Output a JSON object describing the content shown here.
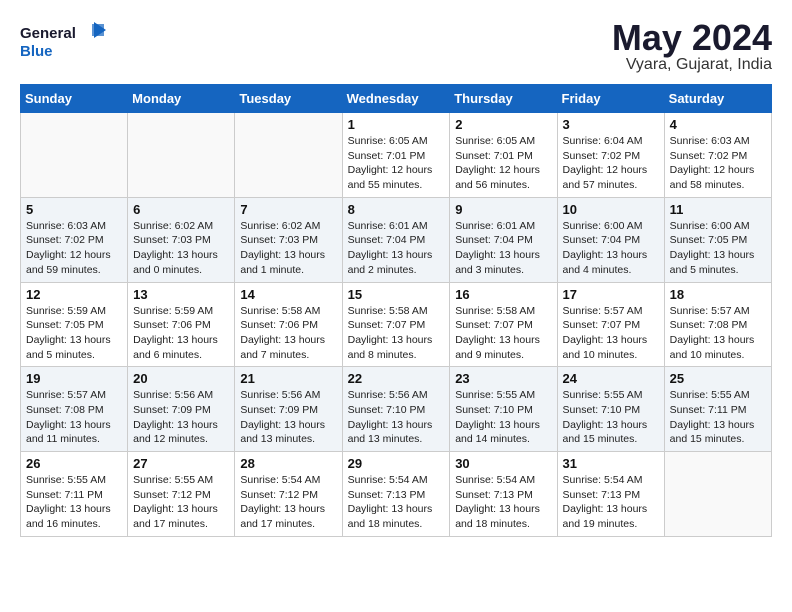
{
  "logo": {
    "line1": "General",
    "line2": "Blue"
  },
  "title": "May 2024",
  "location": "Vyara, Gujarat, India",
  "weekdays": [
    "Sunday",
    "Monday",
    "Tuesday",
    "Wednesday",
    "Thursday",
    "Friday",
    "Saturday"
  ],
  "weeks": [
    [
      {
        "day": "",
        "info": ""
      },
      {
        "day": "",
        "info": ""
      },
      {
        "day": "",
        "info": ""
      },
      {
        "day": "1",
        "info": "Sunrise: 6:05 AM\nSunset: 7:01 PM\nDaylight: 12 hours\nand 55 minutes."
      },
      {
        "day": "2",
        "info": "Sunrise: 6:05 AM\nSunset: 7:01 PM\nDaylight: 12 hours\nand 56 minutes."
      },
      {
        "day": "3",
        "info": "Sunrise: 6:04 AM\nSunset: 7:02 PM\nDaylight: 12 hours\nand 57 minutes."
      },
      {
        "day": "4",
        "info": "Sunrise: 6:03 AM\nSunset: 7:02 PM\nDaylight: 12 hours\nand 58 minutes."
      }
    ],
    [
      {
        "day": "5",
        "info": "Sunrise: 6:03 AM\nSunset: 7:02 PM\nDaylight: 12 hours\nand 59 minutes."
      },
      {
        "day": "6",
        "info": "Sunrise: 6:02 AM\nSunset: 7:03 PM\nDaylight: 13 hours\nand 0 minutes."
      },
      {
        "day": "7",
        "info": "Sunrise: 6:02 AM\nSunset: 7:03 PM\nDaylight: 13 hours\nand 1 minute."
      },
      {
        "day": "8",
        "info": "Sunrise: 6:01 AM\nSunset: 7:04 PM\nDaylight: 13 hours\nand 2 minutes."
      },
      {
        "day": "9",
        "info": "Sunrise: 6:01 AM\nSunset: 7:04 PM\nDaylight: 13 hours\nand 3 minutes."
      },
      {
        "day": "10",
        "info": "Sunrise: 6:00 AM\nSunset: 7:04 PM\nDaylight: 13 hours\nand 4 minutes."
      },
      {
        "day": "11",
        "info": "Sunrise: 6:00 AM\nSunset: 7:05 PM\nDaylight: 13 hours\nand 5 minutes."
      }
    ],
    [
      {
        "day": "12",
        "info": "Sunrise: 5:59 AM\nSunset: 7:05 PM\nDaylight: 13 hours\nand 5 minutes."
      },
      {
        "day": "13",
        "info": "Sunrise: 5:59 AM\nSunset: 7:06 PM\nDaylight: 13 hours\nand 6 minutes."
      },
      {
        "day": "14",
        "info": "Sunrise: 5:58 AM\nSunset: 7:06 PM\nDaylight: 13 hours\nand 7 minutes."
      },
      {
        "day": "15",
        "info": "Sunrise: 5:58 AM\nSunset: 7:07 PM\nDaylight: 13 hours\nand 8 minutes."
      },
      {
        "day": "16",
        "info": "Sunrise: 5:58 AM\nSunset: 7:07 PM\nDaylight: 13 hours\nand 9 minutes."
      },
      {
        "day": "17",
        "info": "Sunrise: 5:57 AM\nSunset: 7:07 PM\nDaylight: 13 hours\nand 10 minutes."
      },
      {
        "day": "18",
        "info": "Sunrise: 5:57 AM\nSunset: 7:08 PM\nDaylight: 13 hours\nand 10 minutes."
      }
    ],
    [
      {
        "day": "19",
        "info": "Sunrise: 5:57 AM\nSunset: 7:08 PM\nDaylight: 13 hours\nand 11 minutes."
      },
      {
        "day": "20",
        "info": "Sunrise: 5:56 AM\nSunset: 7:09 PM\nDaylight: 13 hours\nand 12 minutes."
      },
      {
        "day": "21",
        "info": "Sunrise: 5:56 AM\nSunset: 7:09 PM\nDaylight: 13 hours\nand 13 minutes."
      },
      {
        "day": "22",
        "info": "Sunrise: 5:56 AM\nSunset: 7:10 PM\nDaylight: 13 hours\nand 13 minutes."
      },
      {
        "day": "23",
        "info": "Sunrise: 5:55 AM\nSunset: 7:10 PM\nDaylight: 13 hours\nand 14 minutes."
      },
      {
        "day": "24",
        "info": "Sunrise: 5:55 AM\nSunset: 7:10 PM\nDaylight: 13 hours\nand 15 minutes."
      },
      {
        "day": "25",
        "info": "Sunrise: 5:55 AM\nSunset: 7:11 PM\nDaylight: 13 hours\nand 15 minutes."
      }
    ],
    [
      {
        "day": "26",
        "info": "Sunrise: 5:55 AM\nSunset: 7:11 PM\nDaylight: 13 hours\nand 16 minutes."
      },
      {
        "day": "27",
        "info": "Sunrise: 5:55 AM\nSunset: 7:12 PM\nDaylight: 13 hours\nand 17 minutes."
      },
      {
        "day": "28",
        "info": "Sunrise: 5:54 AM\nSunset: 7:12 PM\nDaylight: 13 hours\nand 17 minutes."
      },
      {
        "day": "29",
        "info": "Sunrise: 5:54 AM\nSunset: 7:13 PM\nDaylight: 13 hours\nand 18 minutes."
      },
      {
        "day": "30",
        "info": "Sunrise: 5:54 AM\nSunset: 7:13 PM\nDaylight: 13 hours\nand 18 minutes."
      },
      {
        "day": "31",
        "info": "Sunrise: 5:54 AM\nSunset: 7:13 PM\nDaylight: 13 hours\nand 19 minutes."
      },
      {
        "day": "",
        "info": ""
      }
    ]
  ]
}
